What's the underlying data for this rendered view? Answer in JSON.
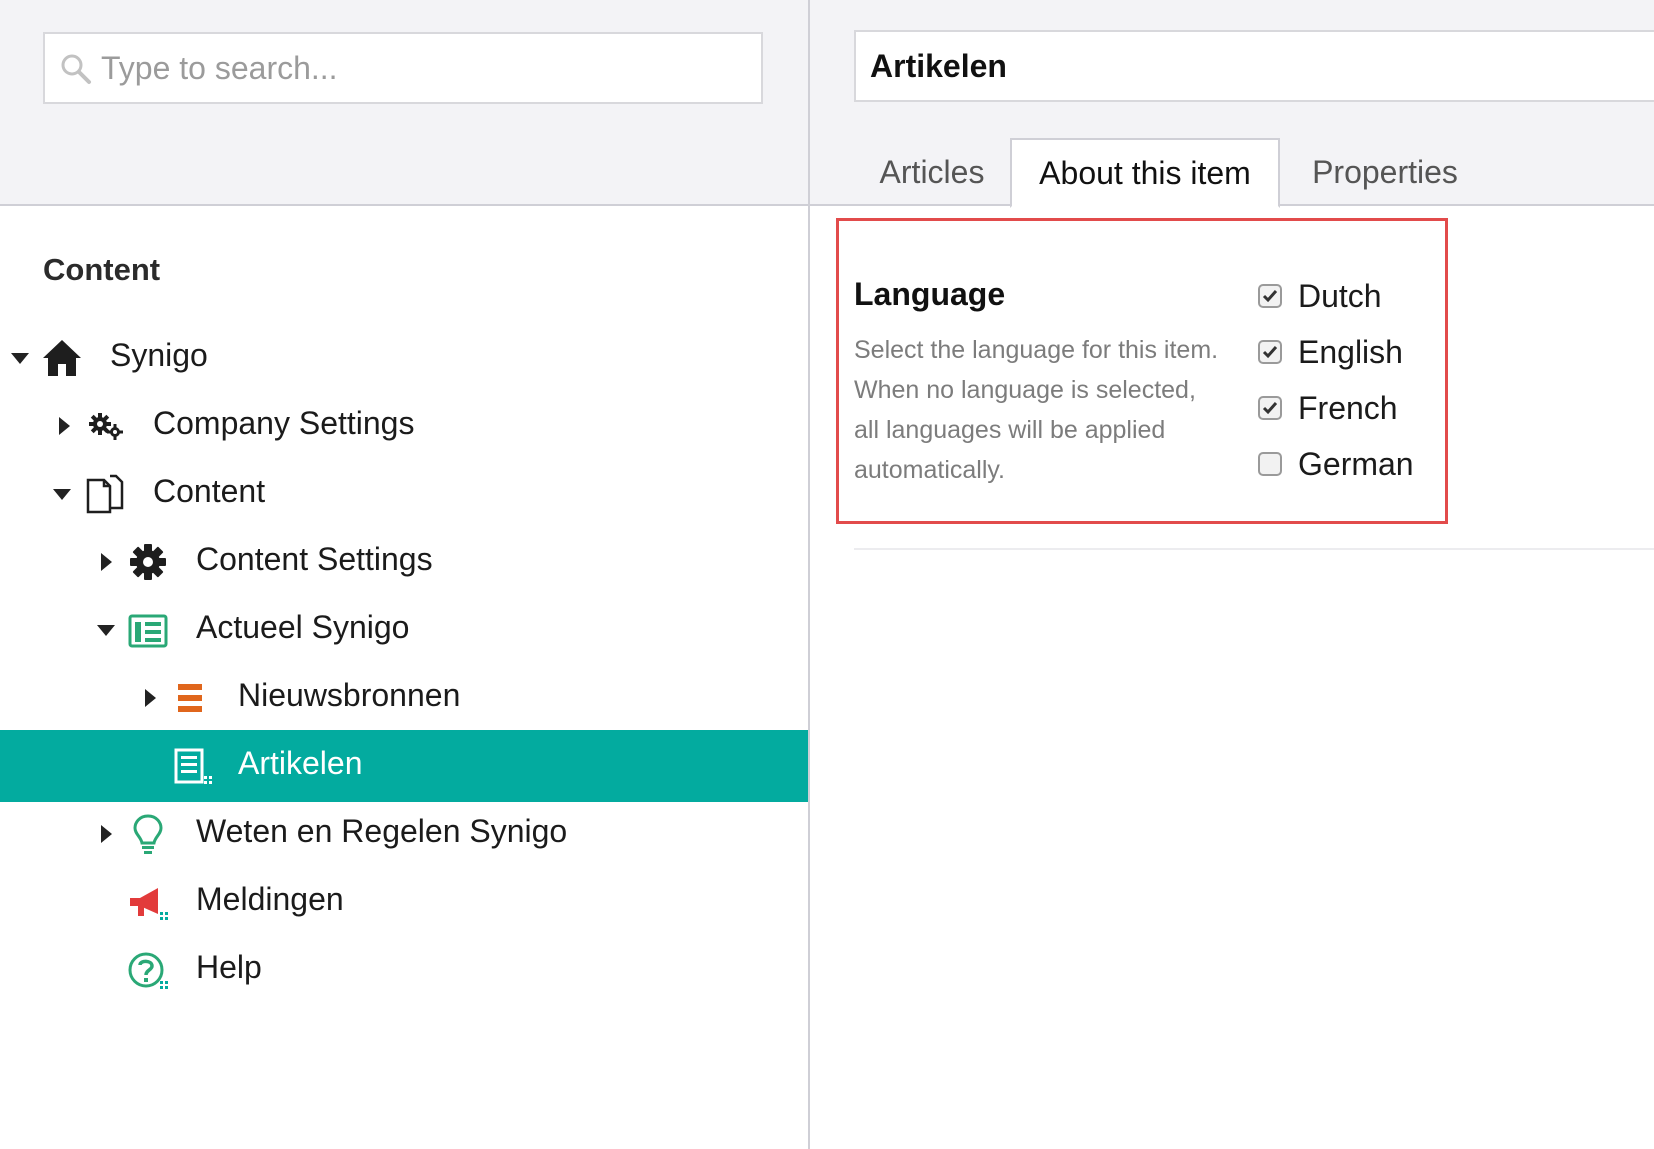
{
  "search": {
    "placeholder": "Type to search..."
  },
  "sidebar": {
    "title": "Content",
    "tree": [
      {
        "label": "Synigo",
        "icon": "home-icon"
      },
      {
        "label": "Company Settings",
        "icon": "cogs-icon"
      },
      {
        "label": "Content",
        "icon": "documents-icon"
      },
      {
        "label": "Content Settings",
        "icon": "gear-icon"
      },
      {
        "label": "Actueel Synigo",
        "icon": "newspaper-icon"
      },
      {
        "label": "Nieuwsbronnen",
        "icon": "list-icon"
      },
      {
        "label": "Artikelen",
        "icon": "article-list-icon"
      },
      {
        "label": "Weten en Regelen Synigo",
        "icon": "lightbulb-icon"
      },
      {
        "label": "Meldingen",
        "icon": "megaphone-icon"
      },
      {
        "label": "Help",
        "icon": "help-icon"
      }
    ]
  },
  "editor": {
    "name_value": "Artikelen",
    "tabs": [
      {
        "label": "Articles"
      },
      {
        "label": "About this item"
      },
      {
        "label": "Properties"
      }
    ],
    "property": {
      "title": "Language",
      "description": "Select the language for this item. When no language is selected, all languages will be applied automatically.",
      "options": [
        {
          "label": "Dutch",
          "checked": true
        },
        {
          "label": "English",
          "checked": true
        },
        {
          "label": "French",
          "checked": true
        },
        {
          "label": "German",
          "checked": false
        }
      ]
    }
  },
  "colors": {
    "accent": "#03ab9f",
    "highlight_border": "#e24b4b",
    "icon_green": "#2aa876",
    "icon_orange": "#e0661c",
    "icon_red": "#e23b3b"
  }
}
